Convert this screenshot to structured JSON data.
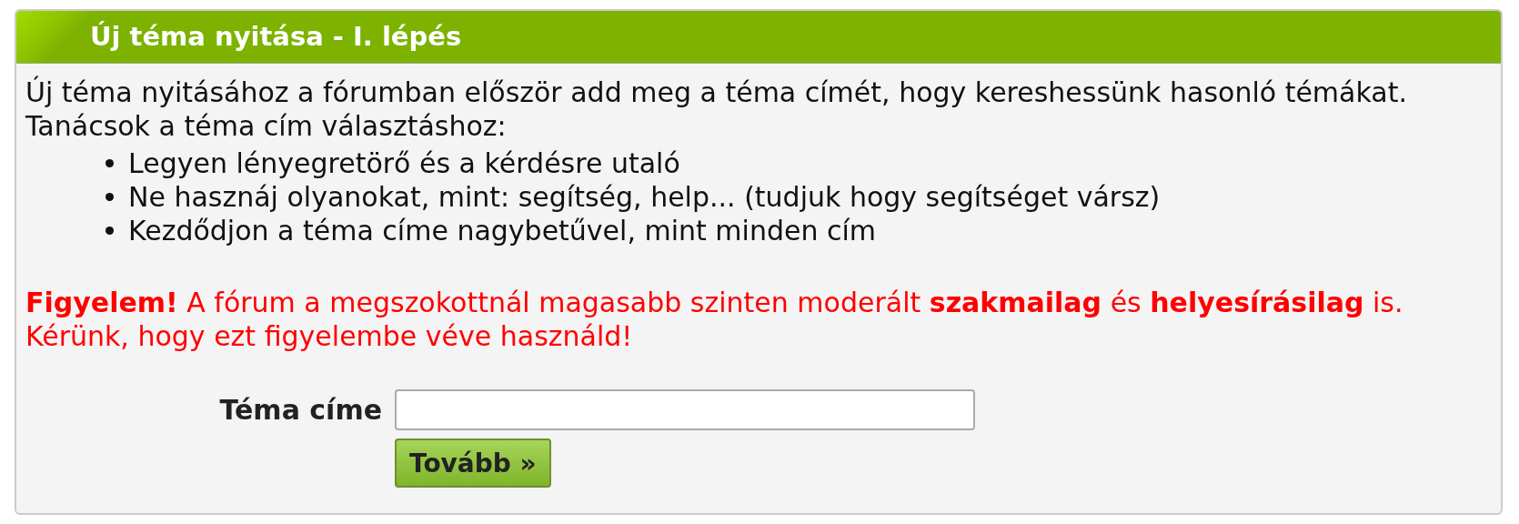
{
  "panel": {
    "title": "Új téma nyitása - I. lépés",
    "intro": "Új téma nyitásához a fórumban először add meg a téma címét, hogy kereshessünk hasonló témákat.",
    "tips_heading": "Tanácsok a téma cím választáshoz:",
    "tips": [
      "Legyen lényegretörő és a kérdésre utaló",
      "Ne hasznáj olyanokat, mint: segítség, help... (tudjuk hogy segítséget vársz)",
      "Kezdődjon a téma címe nagybetűvel, mint minden cím"
    ],
    "warning": "**Figyelem!** A fórum a megszokottnál magasabb szinten moderált **szakmailag** és **helyesírásilag** is. Kérünk, hogy ezt figyelembe véve használd!",
    "form": {
      "label": "Téma címe",
      "button": "Tovább »"
    }
  }
}
